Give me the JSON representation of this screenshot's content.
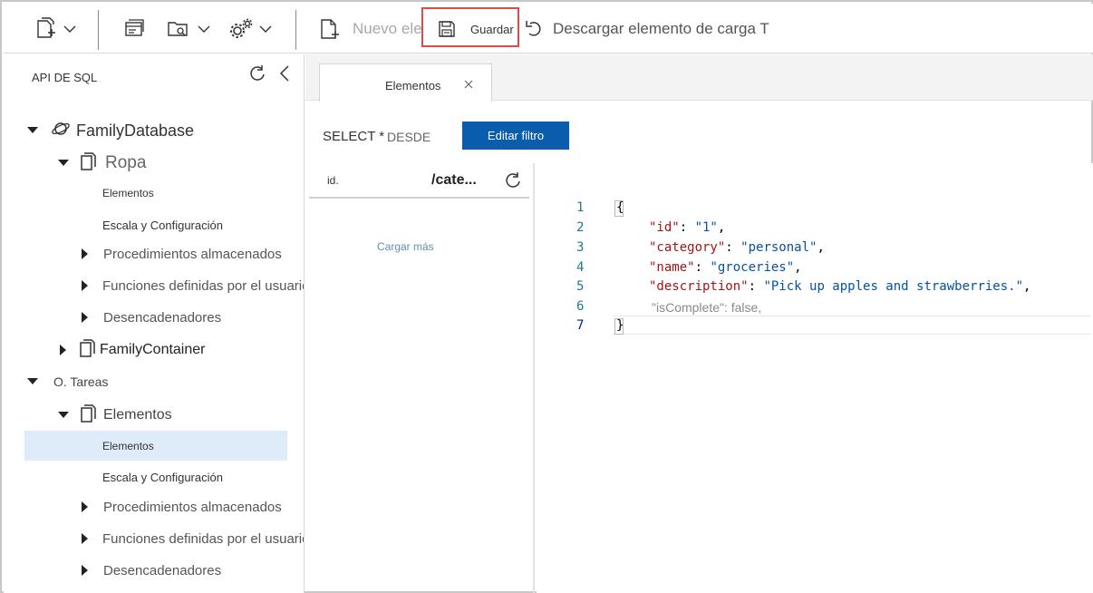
{
  "toolbar": {
    "new_item_label": "Nuevo elemento",
    "save_label": "Guardar",
    "download_label": "Descargar elemento de carga T"
  },
  "sidebar": {
    "title": "API DE SQL",
    "tree": [
      {
        "label": "FamilyDatabase",
        "kind": "database",
        "expanded": true
      },
      {
        "label": "Ropa",
        "kind": "container",
        "expanded": true
      },
      {
        "label": "Elementos",
        "kind": "leaf"
      },
      {
        "label": "Escala y  Configuración",
        "kind": "leaf"
      },
      {
        "label": "Procedimientos almacenados",
        "kind": "group",
        "expanded": false
      },
      {
        "label": "Funciones definidas por el usuario",
        "kind": "group",
        "expanded": false
      },
      {
        "label": "Desencadenadores",
        "kind": "group",
        "expanded": false
      },
      {
        "label": "FamilyContainer",
        "kind": "container",
        "expanded": false
      },
      {
        "label": "O. Tareas",
        "kind": "database",
        "expanded": true
      },
      {
        "label": "Elementos",
        "kind": "container",
        "expanded": true
      },
      {
        "label": "Elementos",
        "kind": "leaf",
        "selected": true
      },
      {
        "label": "Escala y  Configuración",
        "kind": "leaf"
      },
      {
        "label": "Procedimientos almacenados",
        "kind": "group",
        "expanded": false
      },
      {
        "label": "Funciones definidas por el usuario",
        "kind": "group",
        "expanded": false
      },
      {
        "label": "Desencadenadores",
        "kind": "group",
        "expanded": false
      }
    ]
  },
  "tab": {
    "label": "Elementos"
  },
  "query": {
    "select": "SELECT *",
    "from": "DESDE",
    "filter_button": "Editar filtro"
  },
  "list": {
    "col_id": "id.",
    "col_partition": "/cate...",
    "load_more": "Cargar más"
  },
  "editor": {
    "line_numbers": [
      "1",
      "2",
      "3",
      "4",
      "5",
      "6",
      "7"
    ],
    "open_brace": "{",
    "close_brace": "}",
    "fields": [
      {
        "key": "\"id\"",
        "value": "\"1\"",
        "trail": ","
      },
      {
        "key": "\"category\"",
        "value": "\"personal\"",
        "trail": ","
      },
      {
        "key": "\"name\"",
        "value": "\"groceries\"",
        "trail": ","
      },
      {
        "key": "\"description\"",
        "value": "\"Pick up apples and strawberries.\"",
        "trail": ","
      }
    ],
    "line6": "\"isComplete\": false,"
  },
  "colors": {
    "accent": "#0a5cad",
    "selection": "#deecf9",
    "highlight_box": "#e04a4a",
    "json_key": "#a31515",
    "json_string": "#0451a5"
  }
}
